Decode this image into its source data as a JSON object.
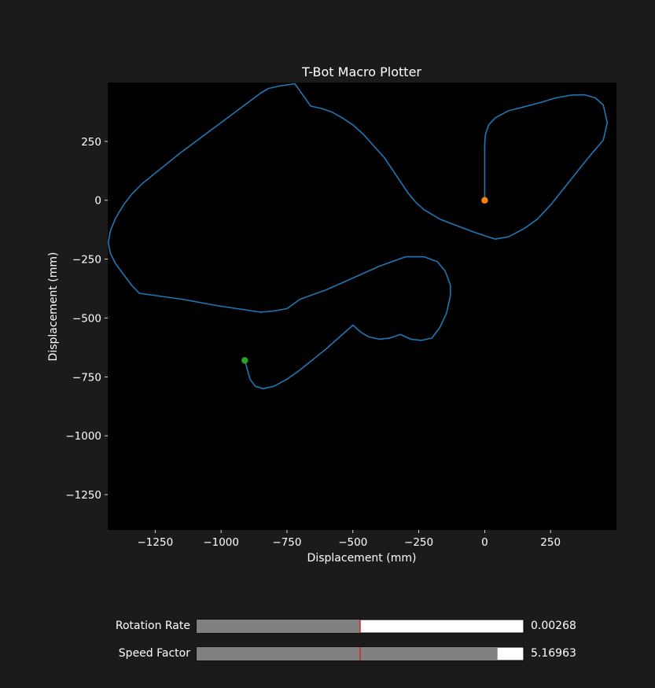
{
  "window": {
    "background": "#1b1b1b"
  },
  "chart_data": {
    "type": "line",
    "title": "T-Bot Macro Plotter",
    "xlabel": "Displacement (mm)",
    "ylabel": "Displacement (mm)",
    "xlim": [
      -1430,
      500
    ],
    "ylim": [
      -1400,
      500
    ],
    "xticks": [
      -1250,
      -1000,
      -750,
      -500,
      -250,
      0,
      250
    ],
    "yticks": [
      250,
      0,
      -250,
      -500,
      -750,
      -1000,
      -1250
    ],
    "tick_labels_x": [
      "−1250",
      "−1000",
      "−750",
      "−500",
      "−250",
      "0",
      "250"
    ],
    "tick_labels_y": [
      "250",
      "0",
      "−250",
      "−500",
      "−750",
      "−1000",
      "−1250"
    ],
    "grid": false,
    "plot_background": "#000000",
    "series": [
      {
        "color": "#1f77b4",
        "x": [
          0,
          0,
          3,
          15,
          40,
          90,
          150,
          210,
          270,
          330,
          380,
          420,
          450,
          465,
          450,
          400,
          350,
          300,
          250,
          200,
          150,
          90,
          40,
          0,
          -40,
          -100,
          -170,
          -230,
          -260,
          -290,
          -320,
          -350,
          -380,
          -420,
          -460,
          -500,
          -540,
          -580,
          -620,
          -660,
          -720,
          -780,
          -820,
          -850,
          -1000,
          -1150,
          -1250,
          -1300,
          -1340,
          -1370,
          -1400,
          -1420,
          -1428,
          -1420,
          -1400,
          -1370,
          -1340,
          -1310,
          -1150,
          -1000,
          -850,
          -800,
          -750,
          -700,
          -600,
          -500,
          -400,
          -300,
          -230,
          -180,
          -150,
          -130,
          -130,
          -145,
          -170,
          -200,
          -240,
          -280,
          -320,
          -360,
          -400,
          -440,
          -470,
          -500,
          -600,
          -700,
          -750,
          -800,
          -840,
          -870,
          -890,
          -900,
          -910
        ],
        "y": [
          0,
          240,
          280,
          320,
          350,
          380,
          397,
          415,
          435,
          447,
          448,
          435,
          405,
          330,
          255,
          190,
          120,
          50,
          -20,
          -80,
          -120,
          -155,
          -165,
          -150,
          -135,
          -110,
          -80,
          -40,
          -10,
          30,
          80,
          130,
          180,
          230,
          280,
          320,
          350,
          375,
          390,
          400,
          495,
          485,
          475,
          455,
          330,
          205,
          115,
          70,
          25,
          -20,
          -75,
          -130,
          -180,
          -225,
          -270,
          -315,
          -360,
          -395,
          -420,
          -450,
          -475,
          -470,
          -460,
          -420,
          -380,
          -330,
          -280,
          -240,
          -240,
          -260,
          -300,
          -360,
          -405,
          -480,
          -540,
          -585,
          -595,
          -590,
          -570,
          -585,
          -590,
          -580,
          -560,
          -530,
          -630,
          -720,
          -760,
          -790,
          -800,
          -790,
          -760,
          -720,
          -680
        ]
      }
    ],
    "markers": [
      {
        "x": 0,
        "y": 0,
        "color": "#ff7f0e"
      },
      {
        "x": -910,
        "y": -680,
        "color": "#2ca02c"
      }
    ]
  },
  "controls": {
    "sliders": [
      {
        "label": "Rotation Rate",
        "value_text": "0.00268",
        "fill_fraction": 0.5,
        "initial_marker_fraction": 0.5,
        "fill_color": "#808080",
        "track_color": "#ffffff",
        "marker_color": "#d62728"
      },
      {
        "label": "Speed Factor",
        "value_text": "5.16963",
        "fill_fraction": 0.92,
        "initial_marker_fraction": 0.5,
        "fill_color": "#808080",
        "track_color": "#ffffff",
        "marker_color": "#d62728"
      }
    ]
  }
}
